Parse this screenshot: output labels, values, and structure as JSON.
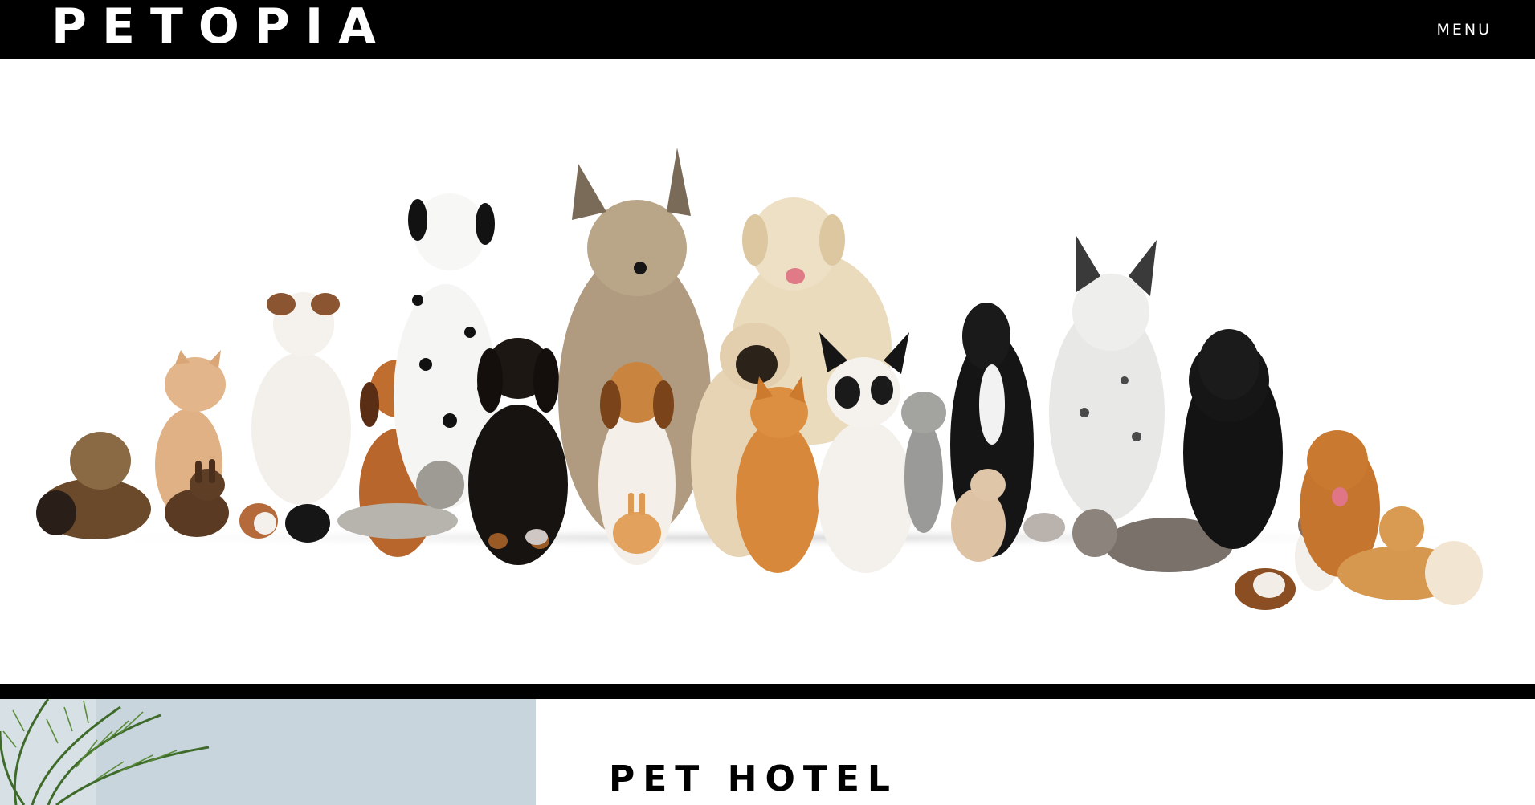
{
  "header": {
    "logo_text": "PETOPIA",
    "menu_label": "MENU"
  },
  "hero": {
    "image_alt": "Group of dogs, cats, rabbits, guinea pigs and mice sitting in a row"
  },
  "section": {
    "title": "PET HOTEL",
    "image_alt": "Palm plant in a bright room"
  },
  "colors": {
    "bar": "#000000",
    "text_light": "#ffffff",
    "text_dark": "#000000"
  }
}
